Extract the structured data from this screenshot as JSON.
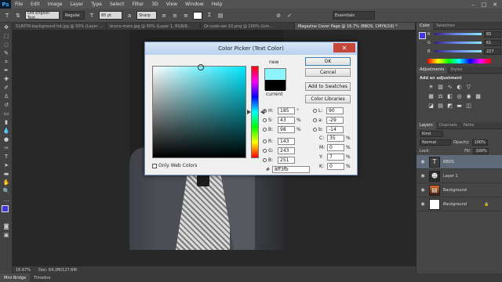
{
  "menubar": {
    "logo": "Ps",
    "items": [
      "File",
      "Edit",
      "Image",
      "Layer",
      "Type",
      "Select",
      "Filter",
      "3D",
      "View",
      "Window",
      "Help"
    ],
    "win_min": "–",
    "win_max": "□",
    "win_close": "✕"
  },
  "options": {
    "font_family": "Old English Text...",
    "font_style": "Regular",
    "font_size": "85 pt",
    "antialias": "Sharp",
    "workspace": "Essentials",
    "text_color": "#ffffff"
  },
  "tabs": [
    {
      "label": "518079-background-hd.jpg @ 50% (Layer ..."
    },
    {
      "label": "bruno-mars.jpg @ 50% (Layer 1, RGB/8..."
    },
    {
      "label": "Qr-code-ver-10.png @ 100% (Lim..."
    },
    {
      "label": "Magazine Cover Page @ 16.7% (BBOS, CMYK/16) *"
    }
  ],
  "status": {
    "zoom": "16.67%",
    "doc": "Doc: 64.2M/127.6M"
  },
  "bottom_tabs": [
    "Mini Bridge",
    "Timeline"
  ],
  "color_panel": {
    "tabs": [
      "Color",
      "Swatches"
    ],
    "r_label": "R",
    "g_label": "G",
    "b_label": "B",
    "r": "65",
    "g": "61",
    "b": "227"
  },
  "adjustments": {
    "tabs": [
      "Adjustments",
      "Styles"
    ],
    "title": "Add an adjustment"
  },
  "layers_panel": {
    "tabs": [
      "Layers",
      "Channels",
      "Paths"
    ],
    "kind": "Kind",
    "blend": "Normal",
    "opacity_label": "Opacity:",
    "opacity": "100%",
    "lock": "Lock:",
    "fill_label": "Fill:",
    "fill": "100%",
    "layers": [
      {
        "name": "BBOS",
        "icon": "T",
        "bg": "#3d3d3d"
      },
      {
        "name": "Layer 1",
        "icon": "☻",
        "bg": "#2b2b2b"
      },
      {
        "name": "Background",
        "icon": "▤",
        "bg": "#8a4a2a"
      },
      {
        "name": "Background",
        "icon": "",
        "bg": "#ffffff"
      }
    ]
  },
  "dialog": {
    "title": "Color Picker (Text Color)",
    "new_label": "new",
    "current_label": "current",
    "ok": "OK",
    "cancel": "Cancel",
    "add_swatches": "Add to Swatches",
    "libraries": "Color Libraries",
    "H": "185",
    "S": "43",
    "Bv": "98",
    "R": "143",
    "G": "243",
    "B": "251",
    "L": "90",
    "a": "-29",
    "b": "-14",
    "C": "35",
    "M": "0",
    "Y": "7",
    "K": "0",
    "hex": "8ff3fb",
    "only_web": "Only Web Colors",
    "deg": "°",
    "pct": "%"
  }
}
